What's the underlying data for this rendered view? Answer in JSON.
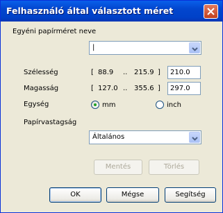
{
  "window": {
    "title": "Felhasználó által választott méret"
  },
  "name_section": {
    "label": "Egyéni papírméret neve",
    "value": "|"
  },
  "width": {
    "label": "Szélesség",
    "range_open": "[",
    "min": "88.9",
    "sep": "..",
    "max": "215.9",
    "range_close": "]",
    "value": "210.0"
  },
  "height": {
    "label": "Magasság",
    "range_open": "[",
    "min": "127.0",
    "sep": "..",
    "max": "355.6",
    "range_close": "]",
    "value": "297.0"
  },
  "unit": {
    "label": "Egység",
    "mm": "mm",
    "inch": "inch",
    "selected": "mm"
  },
  "thickness": {
    "label": "Papírvastagság",
    "value": "Általános"
  },
  "buttons": {
    "save": "Mentés",
    "delete": "Törlés",
    "ok": "OK",
    "cancel": "Mégse",
    "help": "Segítség"
  }
}
